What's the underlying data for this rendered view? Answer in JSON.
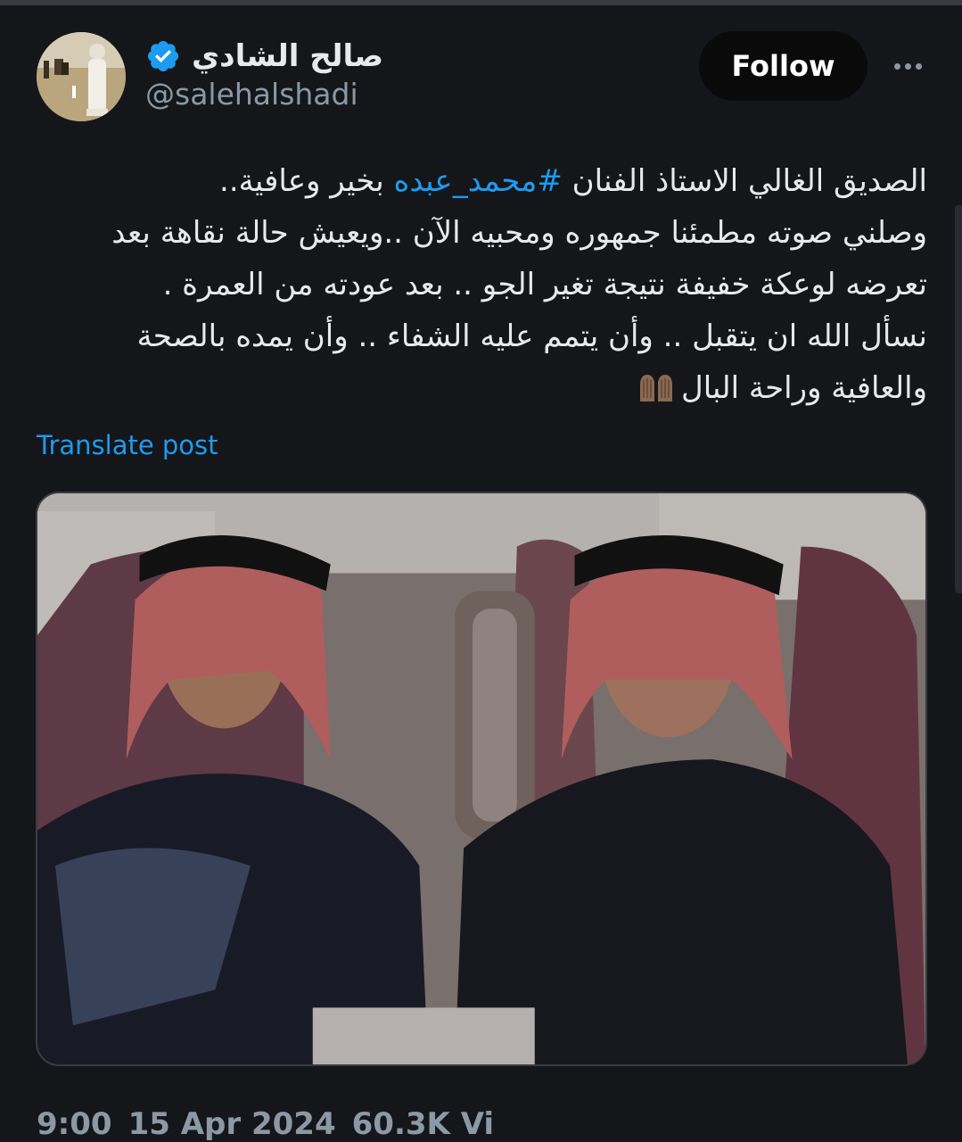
{
  "author": {
    "display_name": "صالح الشادي",
    "handle": "@salehalshadi",
    "avatar_icon": "avatar-photo",
    "verified_icon": "verified-badge-icon"
  },
  "actions": {
    "follow_label": "Follow",
    "more_icon": "more-horizontal-icon"
  },
  "post": {
    "line1_before": "الصديق الغالي الاستاذ الفنان ",
    "hashtag": "#محمد_عبده",
    "line1_after": " بخير وعافية..",
    "line2": "وصلني صوته مطمئنا جمهوره ومحبيه الآن ..ويعيش حالة نقاهة بعد",
    "line3": "تعرضه لوعكة خفيفة  نتيجة تغير الجو .. بعد عودته من العمرة .",
    "line4": "نسأل الله ان يتقبل .. وأن يتمم عليه الشفاء .. وأن يمده بالصحة",
    "line5": "والعافية وراحة البال",
    "emoji_icon": "folded-hands-emoji-icon",
    "translate_label": "Translate post"
  },
  "media": {
    "image_icon": "photo-two-men-in-airplane"
  },
  "meta": {
    "time": "9:00",
    "date": "15 Apr 2024",
    "views": "60.3K Vi"
  },
  "colors": {
    "background": "#15161a",
    "link": "#1d9bf0",
    "verified": "#1d9bf0",
    "secondary_text": "#8b98a5",
    "follow_bg": "#0a0a0b"
  }
}
